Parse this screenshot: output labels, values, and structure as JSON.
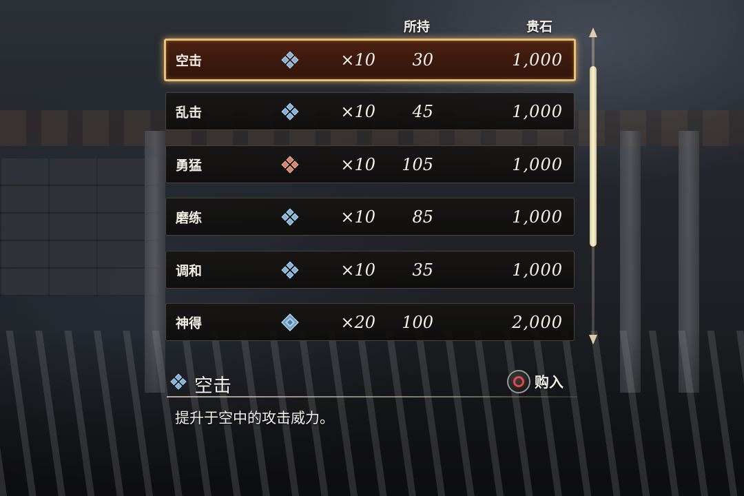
{
  "header": {
    "owned_label": "所持",
    "gems_label": "贵石"
  },
  "items": [
    {
      "name": "空击",
      "icon": "blue-clover-gem-icon",
      "icon_color": "#7fb3e0",
      "quantity": "×10",
      "owned": "30",
      "price": "1,000",
      "selected": true
    },
    {
      "name": "乱击",
      "icon": "blue-clover-gem-icon",
      "icon_color": "#7fb3e0",
      "quantity": "×10",
      "owned": "45",
      "price": "1,000",
      "selected": false
    },
    {
      "name": "勇猛",
      "icon": "red-clover-gem-icon",
      "icon_color": "#d9826a",
      "quantity": "×10",
      "owned": "105",
      "price": "1,000",
      "selected": false
    },
    {
      "name": "磨练",
      "icon": "blue-clover-gem-icon",
      "icon_color": "#7fb3e0",
      "quantity": "×10",
      "owned": "85",
      "price": "1,000",
      "selected": false
    },
    {
      "name": "调和",
      "icon": "blue-clover-gem-icon",
      "icon_color": "#7fb3e0",
      "quantity": "×10",
      "owned": "35",
      "price": "1,000",
      "selected": false
    },
    {
      "name": "神得",
      "icon": "blue-diamond-gem-icon",
      "icon_color": "#7fb3e0",
      "quantity": "×20",
      "owned": "100",
      "price": "2,000",
      "selected": false
    }
  ],
  "detail": {
    "icon": "blue-clover-gem-icon",
    "title": "空击",
    "description": "提升于空中的攻击威力。"
  },
  "buy": {
    "button_icon": "circle-button-icon",
    "label": "购入"
  },
  "colors": {
    "selected_border": "#e9c178",
    "selected_fill": "#3a180d",
    "circle_button_ring": "#e5484d"
  }
}
